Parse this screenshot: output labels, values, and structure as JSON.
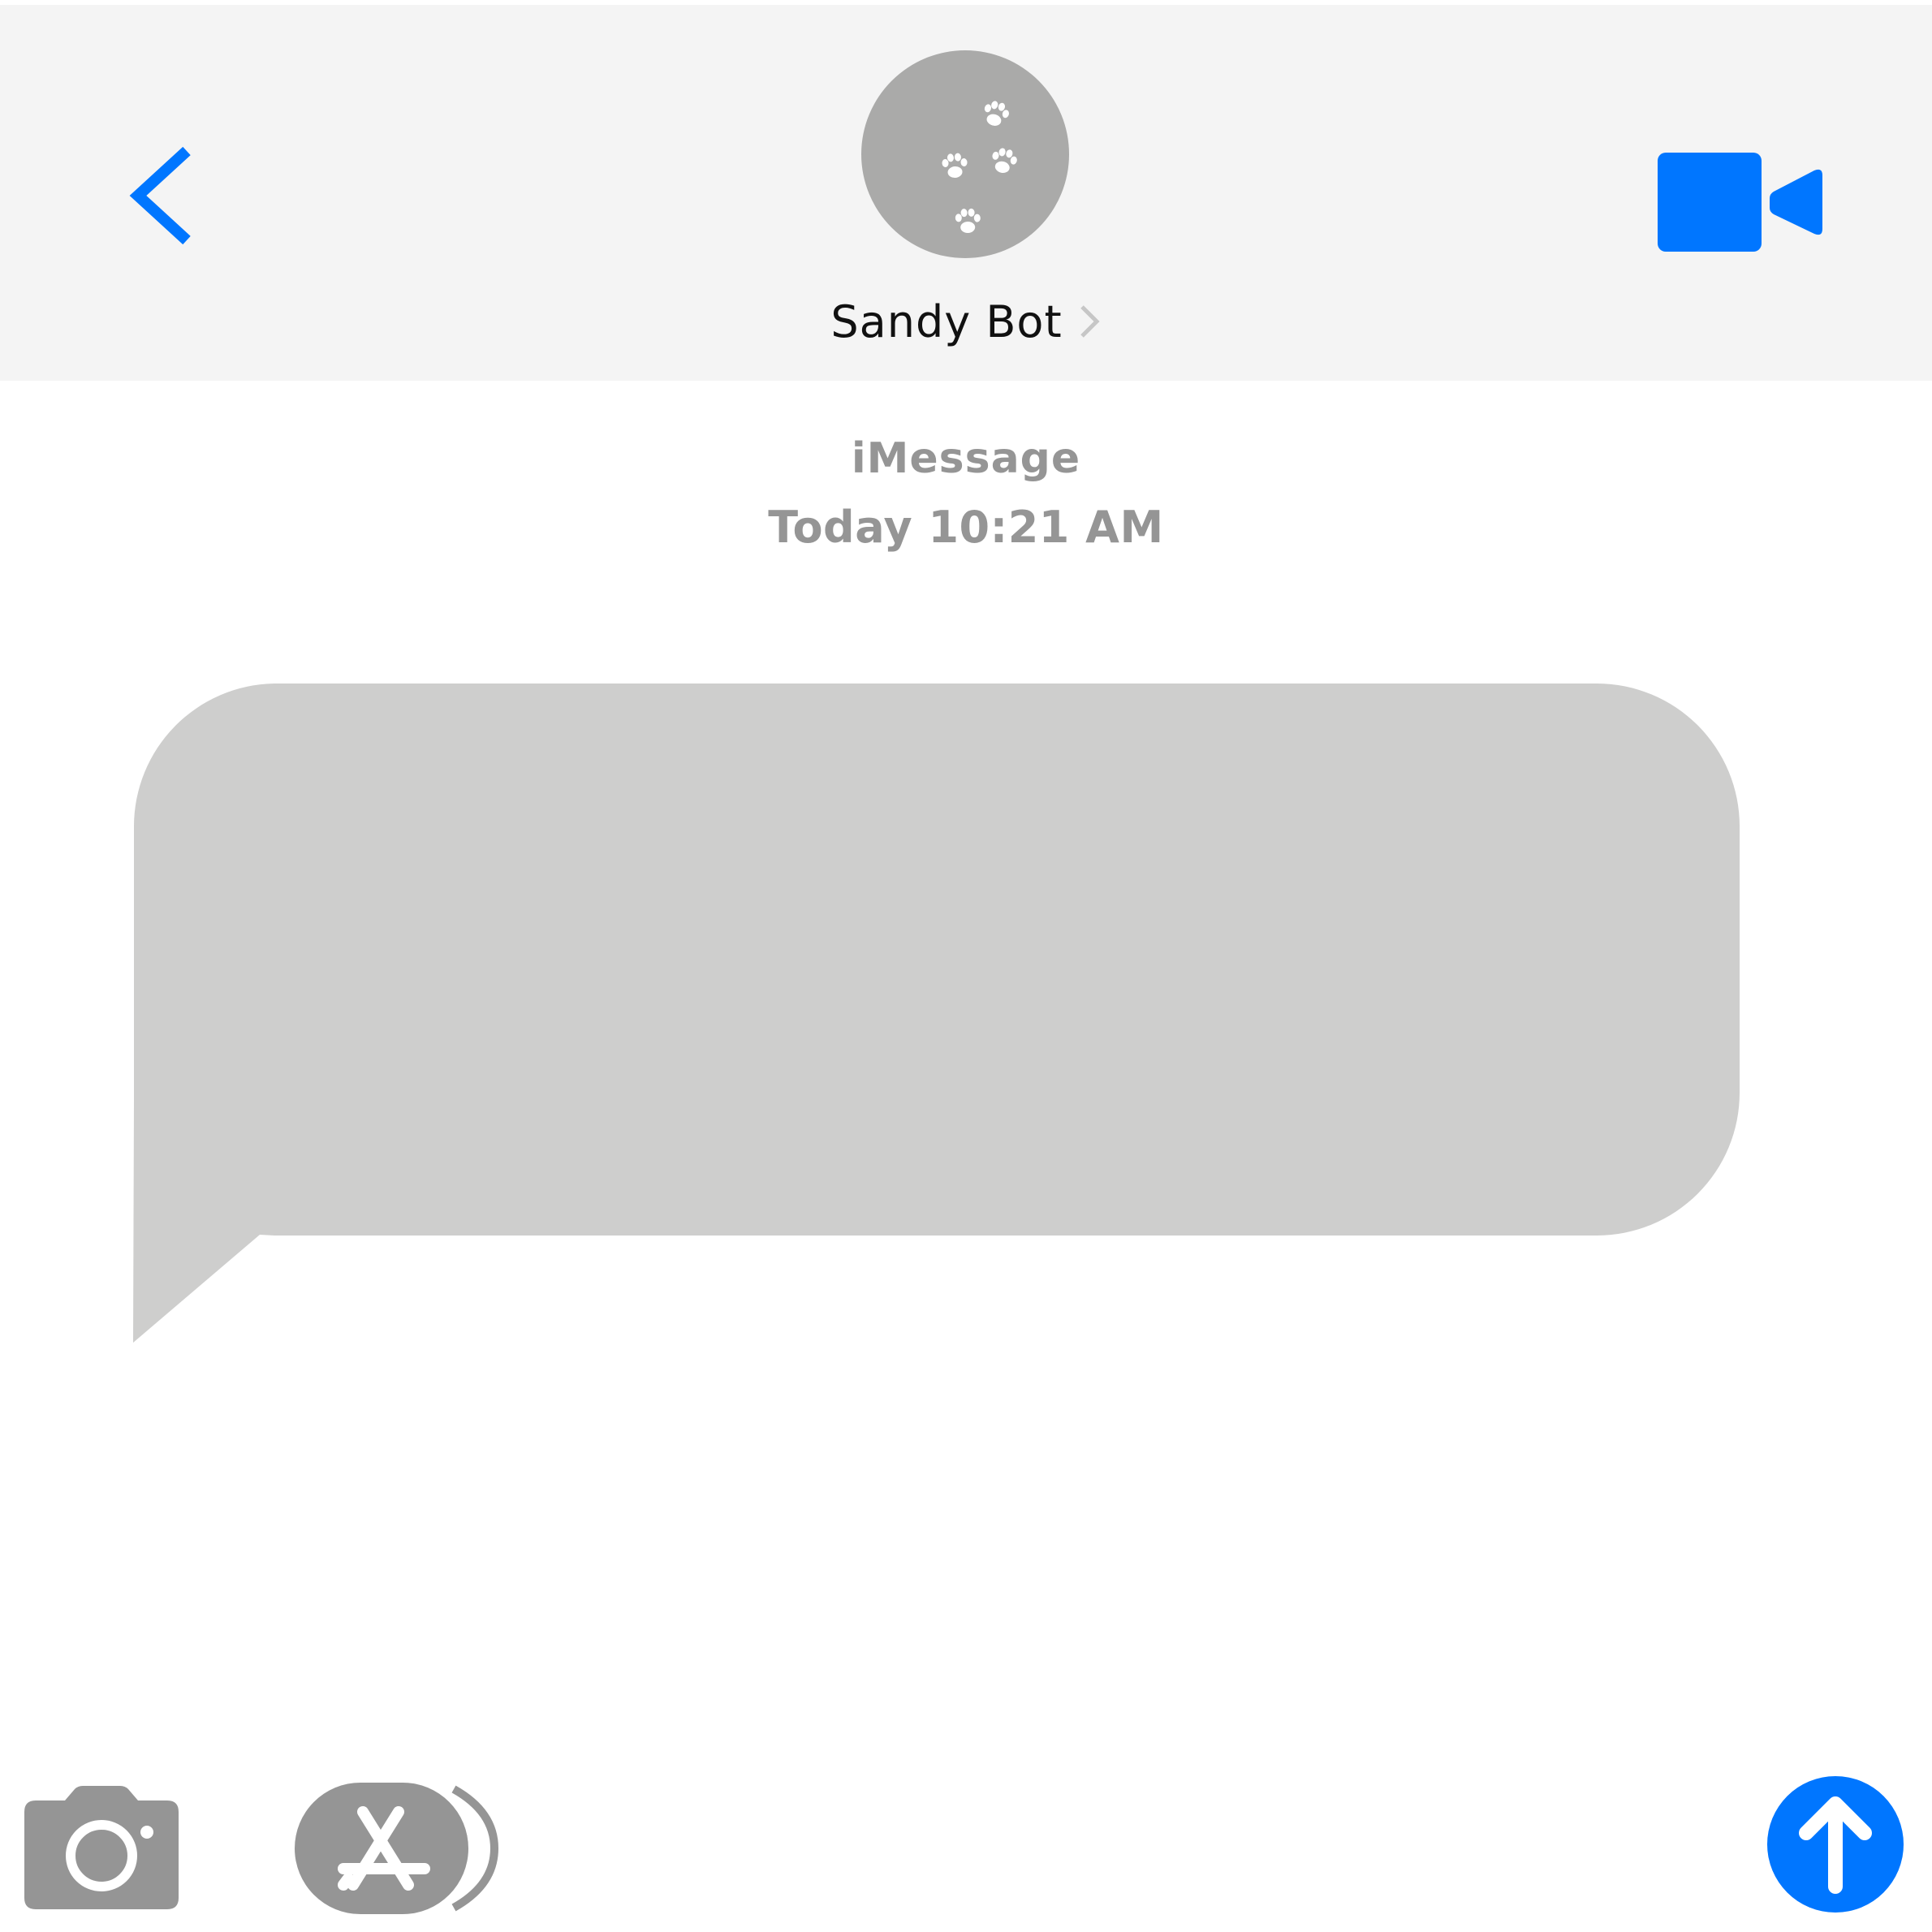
{
  "header": {
    "contact_name": "Sandy Bot",
    "avatar_icon": "paw-prints-icon",
    "back_icon": "chevron-left-icon",
    "video_icon": "video-camera-icon",
    "accent_color": "#0076ff"
  },
  "conversation": {
    "service_label": "iMessage",
    "timestamp": "Today 10:21 AM",
    "messages": [
      {
        "sender": "contact",
        "text": "",
        "bubble_color": "#cececd"
      }
    ]
  },
  "composer": {
    "camera_icon": "camera-icon",
    "apps_icon": "app-store-icon",
    "send_icon": "arrow-up-icon"
  }
}
